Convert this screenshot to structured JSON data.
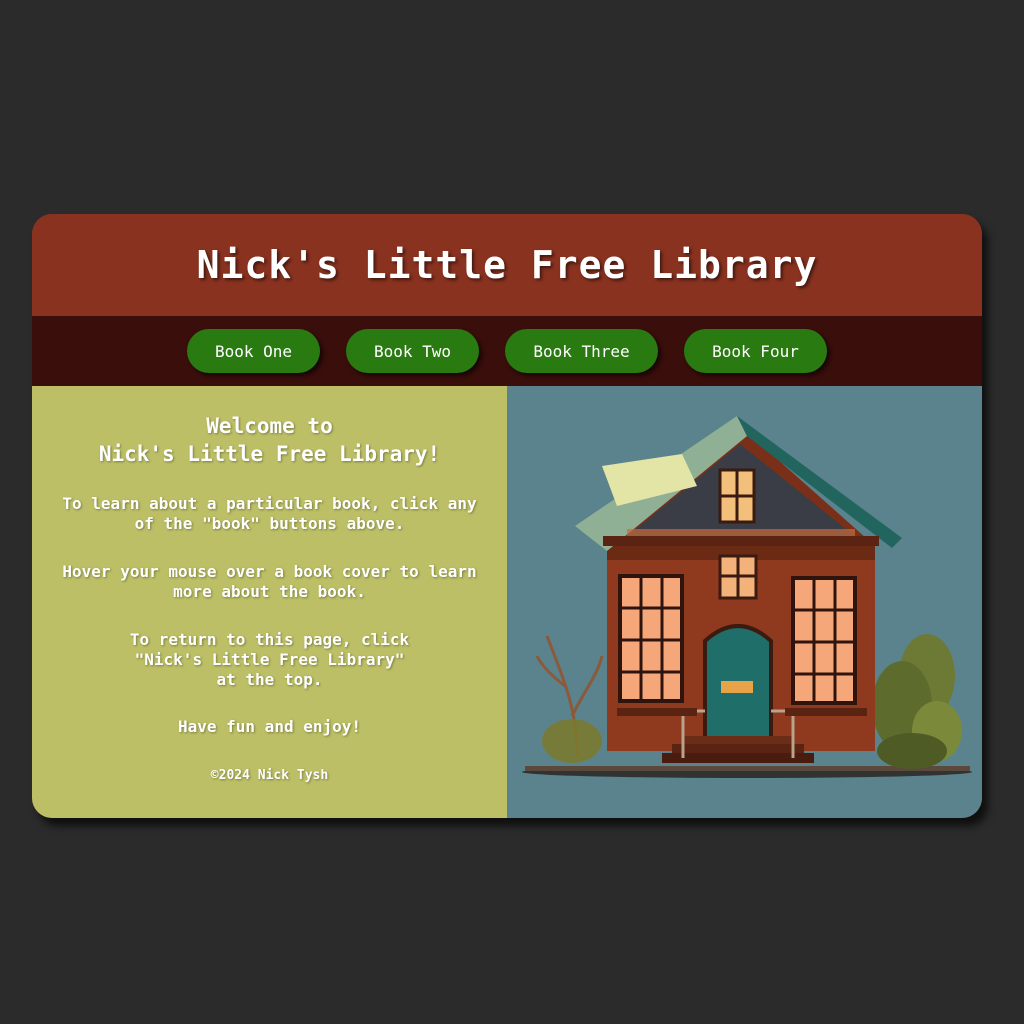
{
  "header": {
    "title": "Nick's Little Free Library"
  },
  "nav": {
    "buttons": [
      {
        "label": "Book One"
      },
      {
        "label": "Book Two"
      },
      {
        "label": "Book Three"
      },
      {
        "label": "Book Four"
      }
    ]
  },
  "intro": {
    "welcome_line1": "Welcome to",
    "welcome_line2": "Nick's Little Free Library!",
    "para1_line1": "To learn about a particular book, click any",
    "para1_line2": "of the \"book\" buttons above.",
    "para2_line1": "Hover your mouse over a book cover to learn",
    "para2_line2": "more about the book.",
    "para3_line1": "To return to this page, click",
    "para3_line2": "\"Nick's Little Free Library\"",
    "para3_line3": "at the top.",
    "para4": "Have fun and enjoy!",
    "copyright": "©2024 Nick Tysh"
  },
  "colors": {
    "page_bg": "#2b2b2b",
    "header_bg": "#8a3220",
    "nav_bg": "#3a0e0b",
    "button_bg": "#2a7a12",
    "left_panel_bg": "#bcbf65",
    "right_panel_bg": "#5a838e"
  },
  "illustration": {
    "icon": "little-free-library-house-icon"
  }
}
